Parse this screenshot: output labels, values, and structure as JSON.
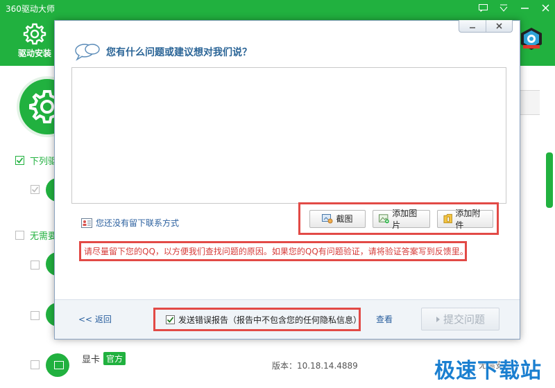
{
  "app": {
    "title": "360驱动大师",
    "nav_tab_label": "驱动安装",
    "colors": {
      "brand_green": "#21b13f",
      "dialog_title_blue": "#2a6496",
      "highlight_red": "#e24a46"
    }
  },
  "background": {
    "group_label_1": "下列驱",
    "group_label_2": "无需要",
    "item_name": "显卡",
    "item_badge": "官方",
    "item_version": "版本：10.18.14.4889",
    "item_action": "无需安"
  },
  "dialog": {
    "minimize_icon": "—",
    "close_icon": "×",
    "title": "您有什么问题或建议想对我们说？",
    "textarea_value": "",
    "contact_link": "您还没有留下联系方式",
    "buttons": {
      "screenshot": "截图",
      "add_image": "添加图片",
      "add_attachment": "添加附件"
    },
    "tip": "请尽量留下您的QQ，以方便我们查找问题的原因。如果您的QQ有问题验证，请将验证答案写到反馈里。",
    "footer": {
      "back": "<< 返回",
      "send_report_checked": true,
      "send_report_label": "发送错误报告（报告中不包含您的任何隐私信息）",
      "view": "查看",
      "submit": "提交问题"
    }
  },
  "watermark": "极速下载站"
}
